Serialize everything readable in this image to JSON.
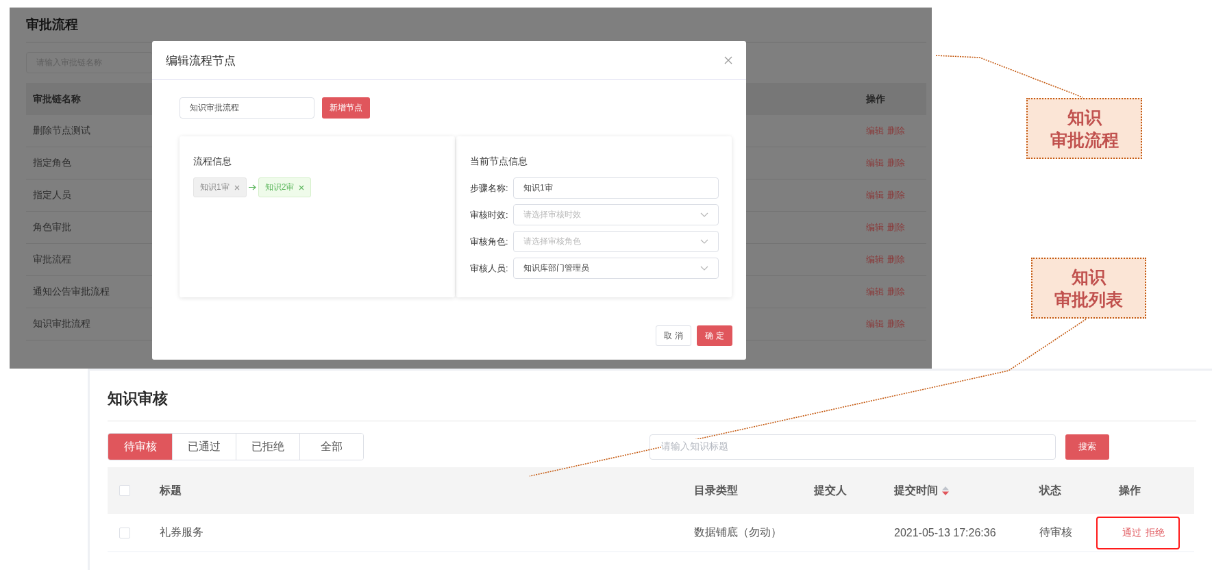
{
  "approval_flow_page": {
    "title": "审批流程",
    "search": {
      "placeholder": "请输入审批链名称"
    },
    "columns": [
      "审批链名称",
      "操作"
    ],
    "rows": [
      {
        "name": "删除节点测试",
        "actions": [
          "编辑",
          "删除"
        ]
      },
      {
        "name": "指定角色",
        "actions": [
          "编辑",
          "删除"
        ]
      },
      {
        "name": "指定人员",
        "actions": [
          "编辑",
          "删除"
        ]
      },
      {
        "name": "角色审批",
        "actions": [
          "编辑",
          "删除"
        ]
      },
      {
        "name": "审批流程",
        "actions": [
          "编辑",
          "删除"
        ]
      },
      {
        "name": "通知公告审批流程",
        "actions": [
          "编辑",
          "删除"
        ]
      },
      {
        "name": "知识审批流程",
        "actions": [
          "编辑",
          "删除"
        ]
      }
    ]
  },
  "edit_node_dialog": {
    "title": "编辑流程节点",
    "flow_name": {
      "value": "知识审批流程"
    },
    "add_button": "新增节点",
    "flow_info": {
      "heading": "流程信息",
      "nodes": [
        {
          "label": "知识1审",
          "selected": false
        },
        {
          "label": "知识2审",
          "selected": true
        }
      ]
    },
    "node_info": {
      "heading": "当前节点信息",
      "fields": [
        {
          "label": "步骤名称:",
          "kind": "text",
          "value": "知识1审"
        },
        {
          "label": "审核时效:",
          "kind": "select",
          "placeholder": "请选择审核时效"
        },
        {
          "label": "审核角色:",
          "kind": "select",
          "placeholder": "请选择审核角色"
        },
        {
          "label": "审核人员:",
          "kind": "select",
          "value": "知识库部门管理员"
        }
      ]
    },
    "buttons": [
      {
        "label": "取 消",
        "kind": "default"
      },
      {
        "label": "确 定",
        "kind": "primary"
      }
    ]
  },
  "callouts": [
    {
      "lines": [
        "知识",
        "审批流程"
      ]
    },
    {
      "lines": [
        "知识",
        "审批列表"
      ]
    }
  ],
  "knowledge_review_page": {
    "title": "知识审核",
    "tabs": [
      {
        "label": "待审核",
        "selected": true
      },
      {
        "label": "已通过",
        "selected": false
      },
      {
        "label": "已拒绝",
        "selected": false
      },
      {
        "label": "全部",
        "selected": false
      }
    ],
    "search": {
      "placeholder": "请输入知识标题"
    },
    "search_button": "搜索",
    "header_checked": false,
    "columns": [
      {
        "label": "标题"
      },
      {
        "label": "目录类型"
      },
      {
        "label": "提交人"
      },
      {
        "label": "提交时间",
        "sortable": true,
        "sorted_descending": true
      },
      {
        "label": "状态"
      },
      {
        "label": "操作"
      }
    ],
    "rows": [
      {
        "checked": false,
        "title": "礼券服务",
        "category": "数据铺底（勿动）",
        "submitted_at": "2021-05-13 17:26:36",
        "status": "待审核",
        "actions": [
          "通过",
          "拒绝"
        ],
        "actions_highlighted": true
      }
    ]
  }
}
